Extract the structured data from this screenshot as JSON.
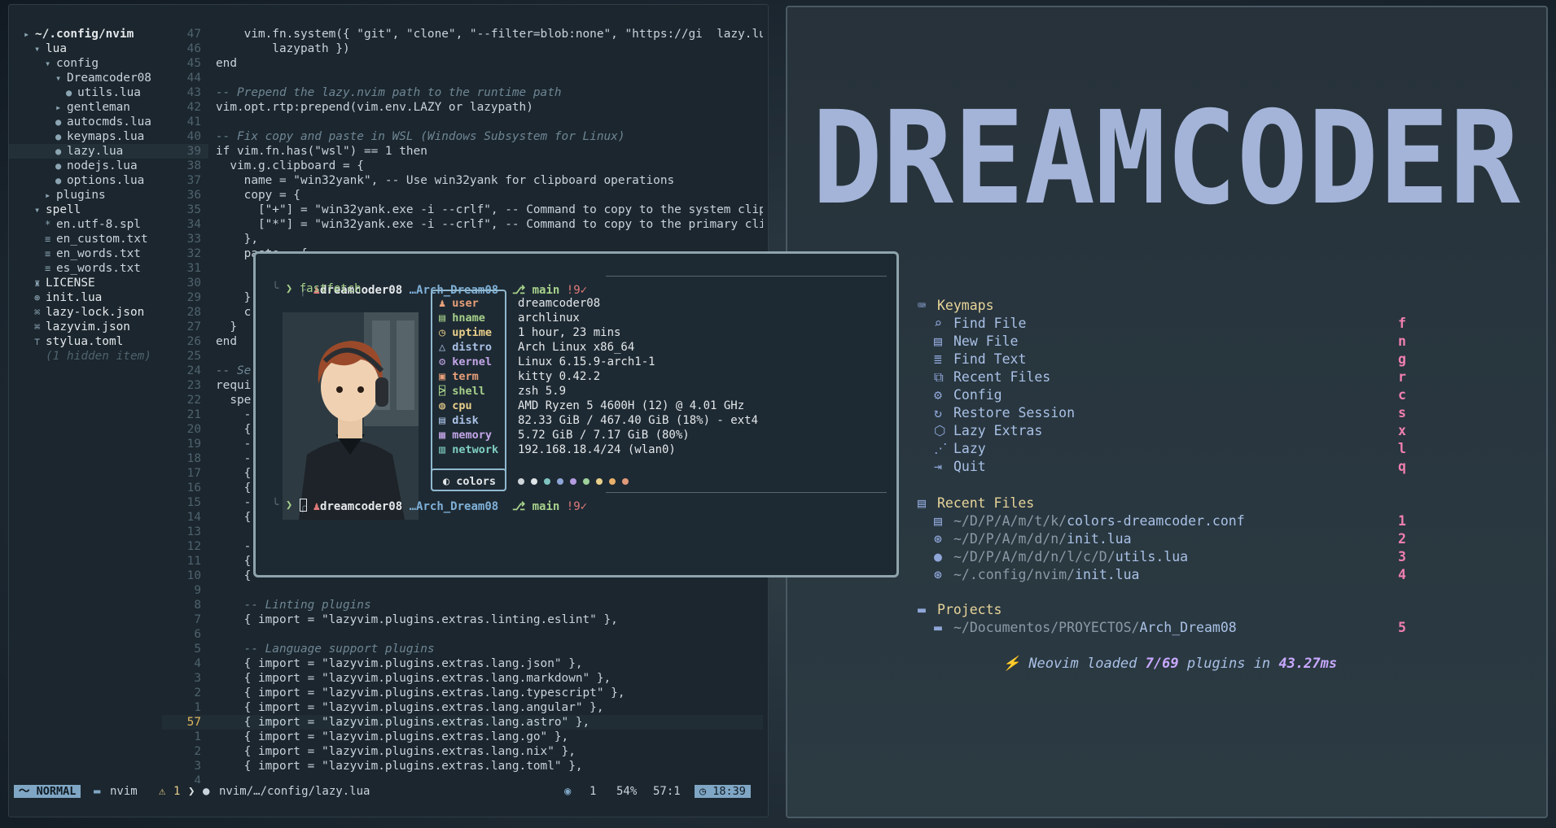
{
  "nvim": {
    "tree": [
      {
        "icon": "▸",
        "text": "~/.config/nvim",
        "indent": 0,
        "bold": true
      },
      {
        "icon": "▾",
        "text": "lua",
        "indent": 1
      },
      {
        "icon": "▾",
        "text": "config",
        "indent": 2
      },
      {
        "icon": "▾",
        "text": "Dreamcoder08",
        "indent": 3
      },
      {
        "icon": "●",
        "text": "utils.lua",
        "indent": 4
      },
      {
        "icon": "▸",
        "text": "gentleman",
        "indent": 3
      },
      {
        "icon": "●",
        "text": "autocmds.lua",
        "indent": 3
      },
      {
        "icon": "●",
        "text": "keymaps.lua",
        "indent": 3
      },
      {
        "icon": "●",
        "text": "lazy.lua",
        "indent": 3,
        "selected": true
      },
      {
        "icon": "●",
        "text": "nodejs.lua",
        "indent": 3
      },
      {
        "icon": "●",
        "text": "options.lua",
        "indent": 3
      },
      {
        "icon": "▸",
        "text": "plugins",
        "indent": 2
      },
      {
        "icon": "▾",
        "text": "spell",
        "indent": 1
      },
      {
        "icon": "*",
        "text": "en.utf-8.spl",
        "indent": 2
      },
      {
        "icon": "≡",
        "text": "en_custom.txt",
        "indent": 2
      },
      {
        "icon": "≡",
        "text": "en_words.txt",
        "indent": 2
      },
      {
        "icon": "≡",
        "text": "es_words.txt",
        "indent": 2
      },
      {
        "icon": "♜",
        "text": "LICENSE",
        "indent": 1
      },
      {
        "icon": "⊛",
        "text": "init.lua",
        "indent": 1
      },
      {
        "icon": "⌘",
        "text": "lazy-lock.json",
        "indent": 1
      },
      {
        "icon": "⌘",
        "text": "lazyvim.json",
        "indent": 1
      },
      {
        "icon": "⊤",
        "text": "stylua.toml",
        "indent": 1
      },
      {
        "icon": "",
        "text": "(1 hidden item)",
        "indent": 1,
        "dim": true
      }
    ],
    "code": [
      {
        "n": "47",
        "t": "    vim.fn.system({ \"git\", \"clone\", \"--filter=blob:none\", \"https://gi  lazy.lua k"
      },
      {
        "n": "46",
        "t": "        lazypath })"
      },
      {
        "n": "45",
        "t": "end"
      },
      {
        "n": "44",
        "t": ""
      },
      {
        "n": "43",
        "t": "-- Prepend the lazy.nvim path to the runtime path",
        "c": true
      },
      {
        "n": "42",
        "t": "vim.opt.rtp:prepend(vim.env.LAZY or lazypath)"
      },
      {
        "n": "41",
        "t": ""
      },
      {
        "n": "40",
        "t": "-- Fix copy and paste in WSL (Windows Subsystem for Linux)",
        "c": true
      },
      {
        "n": "39",
        "t": "if vim.fn.has(\"wsl\") == 1 then"
      },
      {
        "n": "38",
        "t": "  vim.g.clipboard = {"
      },
      {
        "n": "37",
        "t": "    name = \"win32yank\", -- Use win32yank for clipboard operations"
      },
      {
        "n": "36",
        "t": "    copy = {"
      },
      {
        "n": "35",
        "t": "      [\"+\"] = \"win32yank.exe -i --crlf\", -- Command to copy to the system clipboar"
      },
      {
        "n": "34",
        "t": "      [\"*\"] = \"win32yank.exe -i --crlf\", -- Command to copy to the primary clipboa"
      },
      {
        "n": "33",
        "t": "    },"
      },
      {
        "n": "32",
        "t": "    paste = {"
      },
      {
        "n": "31",
        "t": ""
      },
      {
        "n": "30",
        "t": ""
      },
      {
        "n": "29",
        "t": "    },"
      },
      {
        "n": "28",
        "t": "    c"
      },
      {
        "n": "27",
        "t": "  }"
      },
      {
        "n": "26",
        "t": "end"
      },
      {
        "n": "25",
        "t": ""
      },
      {
        "n": "24",
        "t": "-- Se",
        "c": true
      },
      {
        "n": "23",
        "t": "requi"
      },
      {
        "n": "22",
        "t": "  spe"
      },
      {
        "n": "21",
        "t": "    -"
      },
      {
        "n": "20",
        "t": "    {"
      },
      {
        "n": "19",
        "t": "    -"
      },
      {
        "n": "18",
        "t": "    -"
      },
      {
        "n": "17",
        "t": "    {"
      },
      {
        "n": "16",
        "t": "    {"
      },
      {
        "n": "15",
        "t": "    -"
      },
      {
        "n": "14",
        "t": "    {"
      },
      {
        "n": "13",
        "t": ""
      },
      {
        "n": "12",
        "t": "    -"
      },
      {
        "n": "11",
        "t": "    {"
      },
      {
        "n": "10",
        "t": "    {"
      },
      {
        "n": "9",
        "t": ""
      },
      {
        "n": "8",
        "t": "    -- Linting plugins",
        "c": true
      },
      {
        "n": "7",
        "t": "    { import = \"lazyvim.plugins.extras.linting.eslint\" },"
      },
      {
        "n": "6",
        "t": ""
      },
      {
        "n": "5",
        "t": "    -- Language support plugins",
        "c": true
      },
      {
        "n": "4",
        "t": "    { import = \"lazyvim.plugins.extras.lang.json\" },"
      },
      {
        "n": "3",
        "t": "    { import = \"lazyvim.plugins.extras.lang.markdown\" },"
      },
      {
        "n": "2",
        "t": "    { import = \"lazyvim.plugins.extras.lang.typescript\" },"
      },
      {
        "n": "1",
        "t": "    { import = \"lazyvim.plugins.extras.lang.angular\" },"
      },
      {
        "n": "57",
        "t": "    { import = \"lazyvim.plugins.extras.lang.astro\" },",
        "cur": true
      },
      {
        "n": "1",
        "t": "    { import = \"lazyvim.plugins.extras.lang.go\" },"
      },
      {
        "n": "2",
        "t": "    { import = \"lazyvim.plugins.extras.lang.nix\" },"
      },
      {
        "n": "3",
        "t": "    { import = \"lazyvim.plugins.extras.lang.toml\" },"
      },
      {
        "n": "4",
        "t": ""
      }
    ],
    "status": {
      "mode": "NORMAL",
      "branch": "nvim",
      "warnings": "1",
      "file": "nvim/…/config/lazy.lua",
      "right_count": "1",
      "percent": "54%",
      "position": "57:1",
      "time": "18:39"
    }
  },
  "terminal": {
    "prompt": {
      "user": "dreamcoder08",
      "dir": "…Arch_Dream08",
      "git": "main",
      "git_status": "!9✓"
    },
    "command": "fastfetch",
    "fetch": [
      {
        "label": "user",
        "value": "dreamcoder08",
        "color": "#e8a07a",
        "icon": "♟"
      },
      {
        "label": "hname",
        "value": "archlinux",
        "color": "#a7d18b",
        "icon": "▤"
      },
      {
        "label": "uptime",
        "value": "1 hour, 23 mins",
        "color": "#e8cf8a",
        "icon": "◷"
      },
      {
        "label": "distro",
        "value": "Arch Linux x86_64",
        "color": "#a9c1e6",
        "icon": "△"
      },
      {
        "label": "kernel",
        "value": "Linux 6.15.9-arch1-1",
        "color": "#c3a6e8",
        "icon": "⚙"
      },
      {
        "label": "term",
        "value": "kitty 0.42.2",
        "color": "#e8a07a",
        "icon": "▣"
      },
      {
        "label": "shell",
        "value": "zsh 5.9",
        "color": "#a7d18b",
        "icon": "⍄"
      },
      {
        "label": "cpu",
        "value": "AMD Ryzen 5 4600H (12) @ 4.01 GHz",
        "color": "#e8cf8a",
        "icon": "◍"
      },
      {
        "label": "disk",
        "value": "82.33 GiB / 467.40 GiB (18%) - ext4",
        "color": "#a9c1e6",
        "icon": "▤"
      },
      {
        "label": "memory",
        "value": "5.72 GiB / 7.17 GiB (80%)",
        "color": "#c3a6e8",
        "icon": "▦"
      },
      {
        "label": "network",
        "value": "192.168.18.4/24 (wlan0)",
        "color": "#7fd0c4",
        "icon": "▥"
      }
    ],
    "colors_label": "colors",
    "palette": [
      "#cfd6db",
      "#dfe4e7",
      "#7fc4c1",
      "#8fa6d8",
      "#b49be0",
      "#9fd19a",
      "#e8cf8a",
      "#e8b06a",
      "#e09a7a"
    ]
  },
  "dashboard": {
    "logo": "DREAMCODER",
    "keymaps_title": "Keymaps",
    "keymaps": [
      {
        "icon": "⌕",
        "label": "Find File",
        "key": "f"
      },
      {
        "icon": "▤",
        "label": "New File",
        "key": "n"
      },
      {
        "icon": "≣",
        "label": "Find Text",
        "key": "g"
      },
      {
        "icon": "⧉",
        "label": "Recent Files",
        "key": "r"
      },
      {
        "icon": "⚙",
        "label": "Config",
        "key": "c"
      },
      {
        "icon": "↻",
        "label": "Restore Session",
        "key": "s"
      },
      {
        "icon": "⬡",
        "label": "Lazy Extras",
        "key": "x"
      },
      {
        "icon": "⋰",
        "label": "Lazy",
        "key": "l"
      },
      {
        "icon": "⇥",
        "label": "Quit",
        "key": "q"
      }
    ],
    "recent_title": "Recent Files",
    "recent": [
      {
        "icon": "▤",
        "dir": "~/D/P/A/m/t/k/",
        "file": "colors-dreamcoder.conf",
        "key": "1"
      },
      {
        "icon": "⊛",
        "dir": "~/D/P/A/m/d/n/",
        "file": "init.lua",
        "key": "2"
      },
      {
        "icon": "●",
        "dir": "~/D/P/A/m/d/n/l/c/D/",
        "file": "utils.lua",
        "key": "3"
      },
      {
        "icon": "⊛",
        "dir": "~/.config/nvim/",
        "file": "init.lua",
        "key": "4"
      }
    ],
    "projects_title": "Projects",
    "projects": [
      {
        "icon": "▬",
        "dir": "~/Documentos/PROYECTOS/",
        "file": "Arch_Dream08",
        "key": "5"
      }
    ],
    "footer_pre": "⚡ Neovim loaded ",
    "footer_count": "7/69",
    "footer_mid": " plugins in ",
    "footer_time": "43.27ms"
  }
}
